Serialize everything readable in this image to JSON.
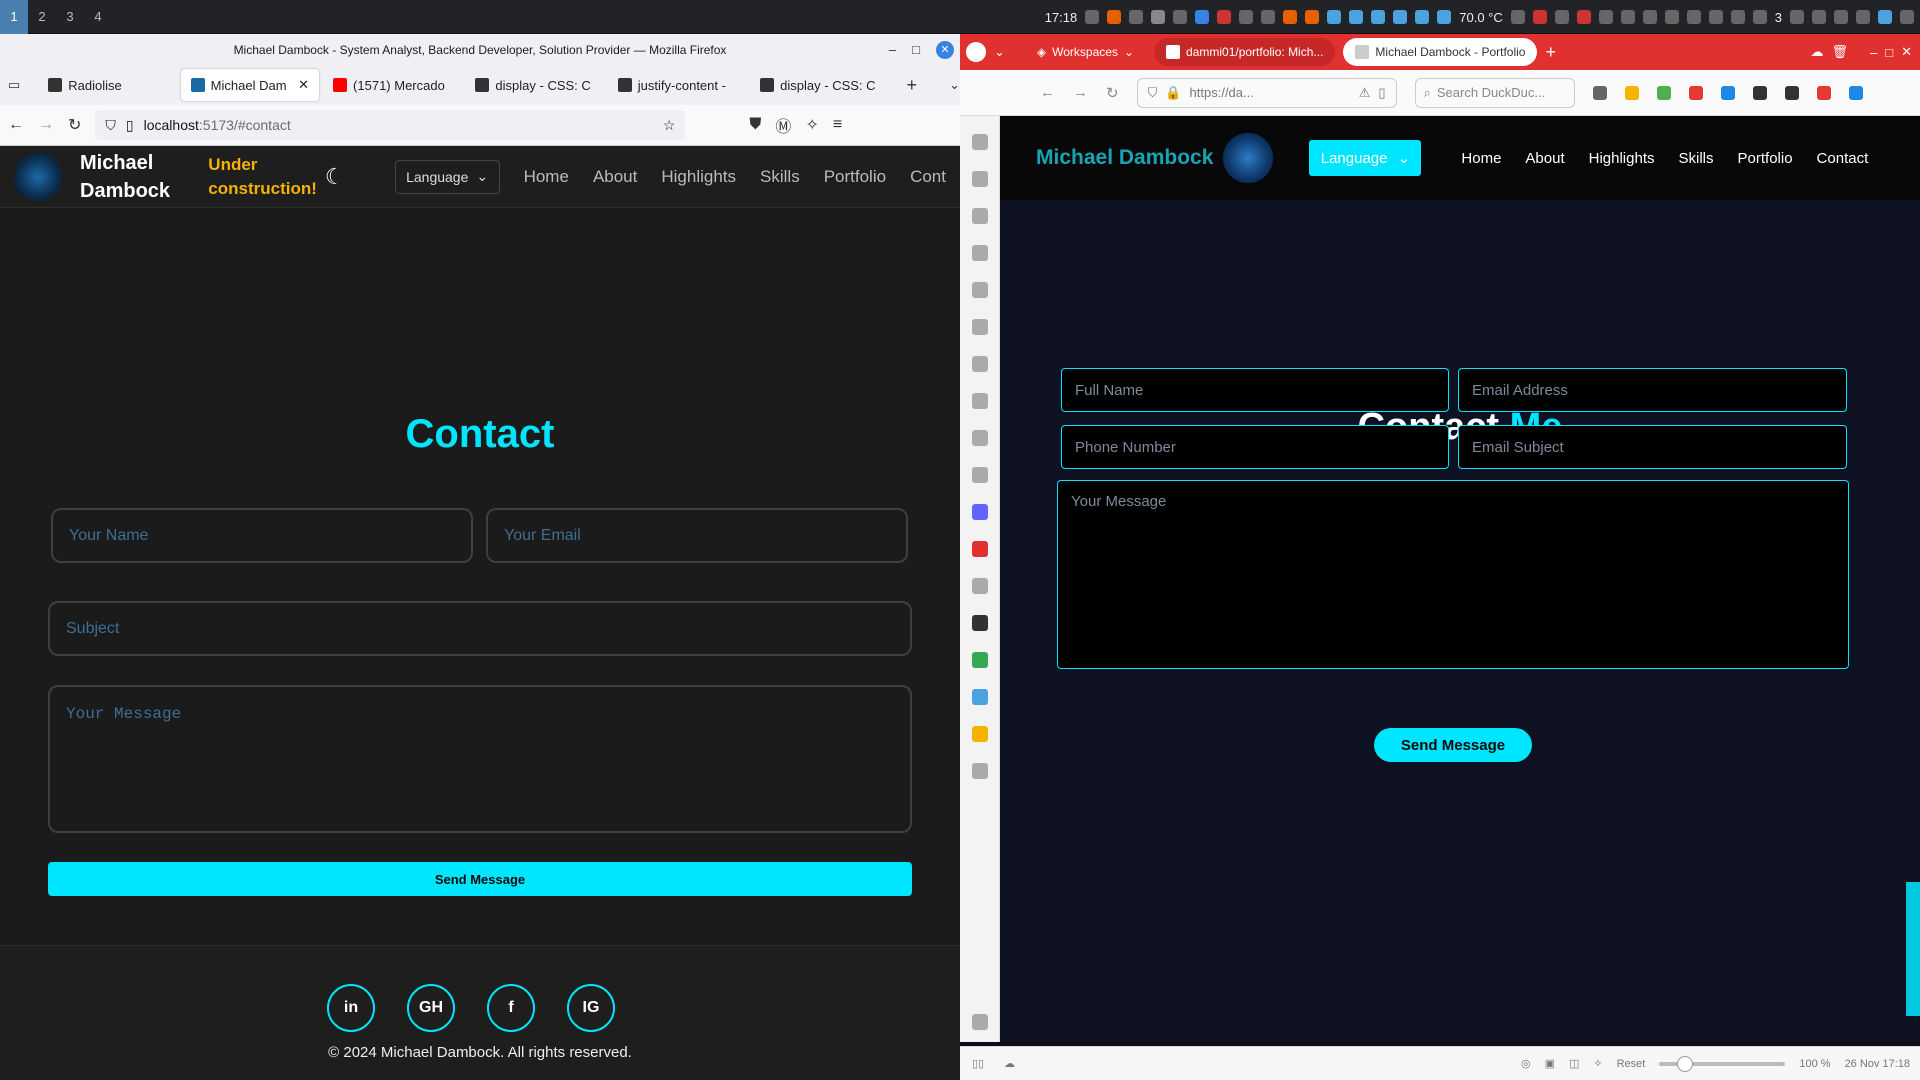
{
  "system": {
    "workspaces": [
      "1",
      "2",
      "3",
      "4"
    ],
    "time": "17:18",
    "temperature": "70.0 °C",
    "counter": "3"
  },
  "firefox": {
    "window_title": "Michael Dambock - System Analyst, Backend Developer, Solution Provider — Mozilla Firefox",
    "tabs": [
      {
        "label": "Radiolise"
      },
      {
        "label": "Michael Dam"
      },
      {
        "label": "(1571) Mercado"
      },
      {
        "label": "display - CSS: C"
      },
      {
        "label": "justify-content -"
      },
      {
        "label": "display - CSS: C"
      }
    ],
    "url_host": "localhost",
    "url_rest": ":5173/#contact"
  },
  "left_page": {
    "name": "Michael Dambock",
    "name_line1": "Michael",
    "name_line2": "Dambock",
    "under_construction_1": "Under",
    "under_construction_2": "construction!",
    "language": "Language",
    "nav": [
      "Home",
      "About",
      "Highlights",
      "Skills",
      "Portfolio",
      "Cont"
    ],
    "heading": "Contact",
    "name_placeholder": "Your Name",
    "email_placeholder": "Your Email",
    "subject_placeholder": "Subject",
    "message_placeholder": "Your Message",
    "send_label": "Send Message",
    "social": [
      "in",
      "GH",
      "f",
      "IG"
    ],
    "copyright": "© 2024 Michael Dambock. All rights reserved."
  },
  "vivaldi": {
    "workspaces_label": "Workspaces",
    "tabs": [
      {
        "label": "dammi01/portfolio: Mich..."
      },
      {
        "label": "Michael Dambock - Portfolio"
      }
    ],
    "url": "https://da...",
    "search_placeholder": "Search DuckDuc...",
    "zoom_reset": "Reset",
    "zoom": "100 %",
    "date": "26 Nov 17:18"
  },
  "right_page": {
    "logo_text": "Michael Dambock",
    "language": "Language",
    "nav": [
      "Home",
      "About",
      "Highlights",
      "Skills",
      "Portfolio",
      "Contact"
    ],
    "heading_a": "Contact",
    "heading_b": "Me",
    "full_name": "Full Name",
    "email_address": "Email Address",
    "phone": "Phone Number",
    "email_subject": "Email Subject",
    "message": "Your Message",
    "send_label": "Send Message"
  },
  "colors": {
    "accent": "#00e5ff",
    "warning": "#f5b300"
  }
}
